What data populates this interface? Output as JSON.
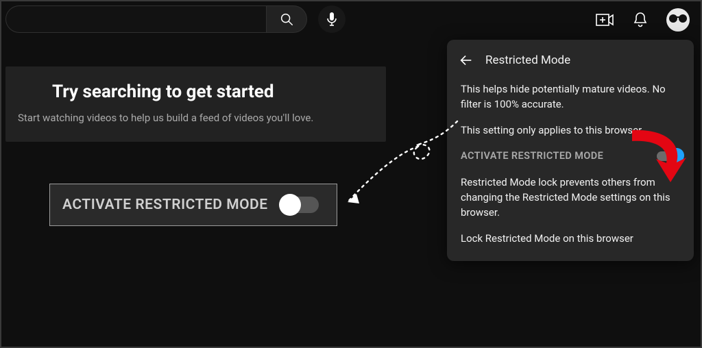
{
  "search": {
    "value": "",
    "placeholder": ""
  },
  "icons": {
    "search": "search-icon",
    "mic": "mic-icon",
    "create": "create-video-icon",
    "notifications": "bell-icon",
    "avatar": "avatar"
  },
  "empty_state": {
    "title": "Try searching to get started",
    "subtitle": "Start watching videos to help us build a feed of videos you'll love."
  },
  "highlight_toggle": {
    "label": "ACTIVATE RESTRICTED MODE",
    "on": false
  },
  "panel": {
    "title": "Restricted Mode",
    "desc1": "This helps hide potentially mature videos. No filter is 100% accurate.",
    "desc2": "This setting only applies to this browser.",
    "toggle_label": "ACTIVATE RESTRICTED MODE",
    "toggle_on": true,
    "desc3": "Restricted Mode lock prevents others from changing the Restricted Mode settings on this browser.",
    "lock_text": "Lock Restricted Mode on this browser"
  }
}
